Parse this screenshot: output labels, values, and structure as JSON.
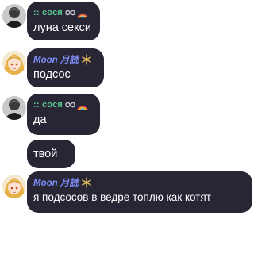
{
  "messages": [
    {
      "author": ":: сося",
      "text": "луна секси"
    },
    {
      "author": "Moon 月読",
      "text": "подсос"
    },
    {
      "author": ":: сося",
      "text": "да"
    },
    {
      "text": "твой"
    },
    {
      "author": "Moon 月読",
      "text": "я подсосов в ведре топлю как котят"
    }
  ],
  "colors": {
    "bubble": "#282535",
    "name_sosya": "#58c98f",
    "name_moon": "#7d8ef7",
    "text": "#ffffff"
  },
  "icons": [
    "infinity-icon",
    "rainbow-icon",
    "snowflake-badge-icon"
  ]
}
